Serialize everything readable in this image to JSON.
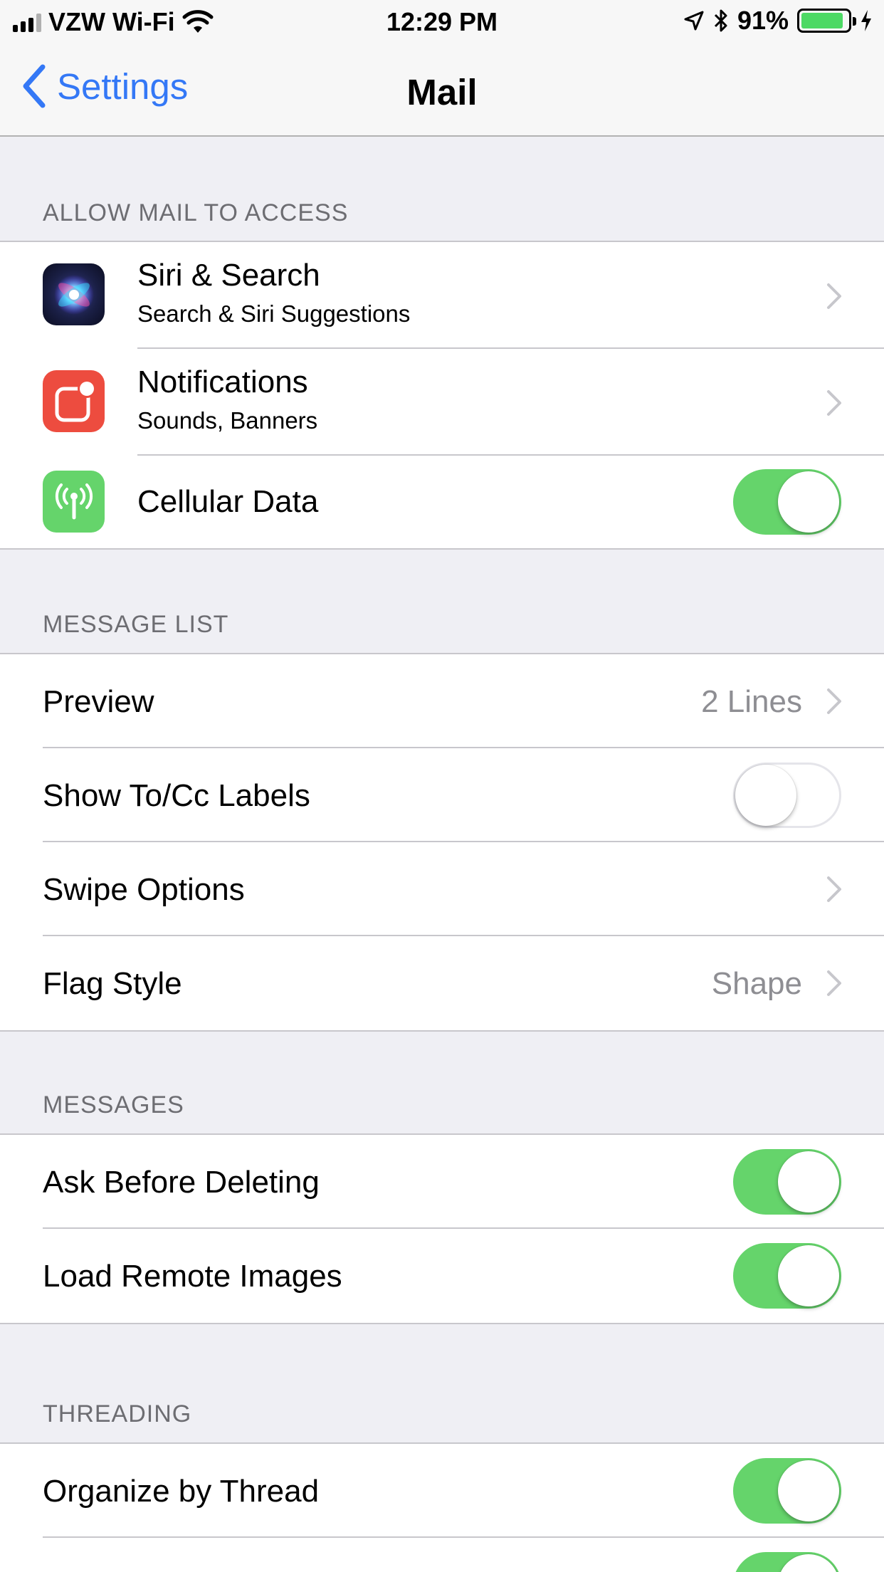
{
  "status_bar": {
    "carrier": "VZW Wi-Fi",
    "time": "12:29 PM",
    "battery": "91%",
    "battery_level": 0.91
  },
  "nav": {
    "back_label": "Settings",
    "title": "Mail"
  },
  "sections": {
    "access": {
      "header": "ALLOW MAIL TO ACCESS",
      "siri": {
        "label": "Siri & Search",
        "sub": "Search & Siri Suggestions"
      },
      "notifications": {
        "label": "Notifications",
        "sub": "Sounds, Banners"
      },
      "cellular": {
        "label": "Cellular Data",
        "on": true
      }
    },
    "message_list": {
      "header": "MESSAGE LIST",
      "preview": {
        "label": "Preview",
        "value": "2 Lines"
      },
      "show_tocc": {
        "label": "Show To/Cc Labels",
        "on": false
      },
      "swipe": {
        "label": "Swipe Options"
      },
      "flag": {
        "label": "Flag Style",
        "value": "Shape"
      }
    },
    "messages": {
      "header": "MESSAGES",
      "ask_delete": {
        "label": "Ask Before Deleting",
        "on": true
      },
      "remote_images": {
        "label": "Load Remote Images",
        "on": true
      }
    },
    "threading": {
      "header": "THREADING",
      "organize": {
        "label": "Organize by Thread",
        "on": true
      },
      "next_toggle": {
        "on": true
      }
    }
  },
  "colors": {
    "accent": "#3478f6",
    "toggle_on": "#65d46b",
    "battery": "#4cd964",
    "notifications_icon": "#ed4c3f",
    "cellular_icon": "#65d46b"
  },
  "icons": {
    "siri": "siri-icon",
    "notifications": "notifications-icon",
    "cellular": "antenna-icon",
    "chevron": "chevron-right-icon",
    "back": "chevron-left-icon"
  }
}
